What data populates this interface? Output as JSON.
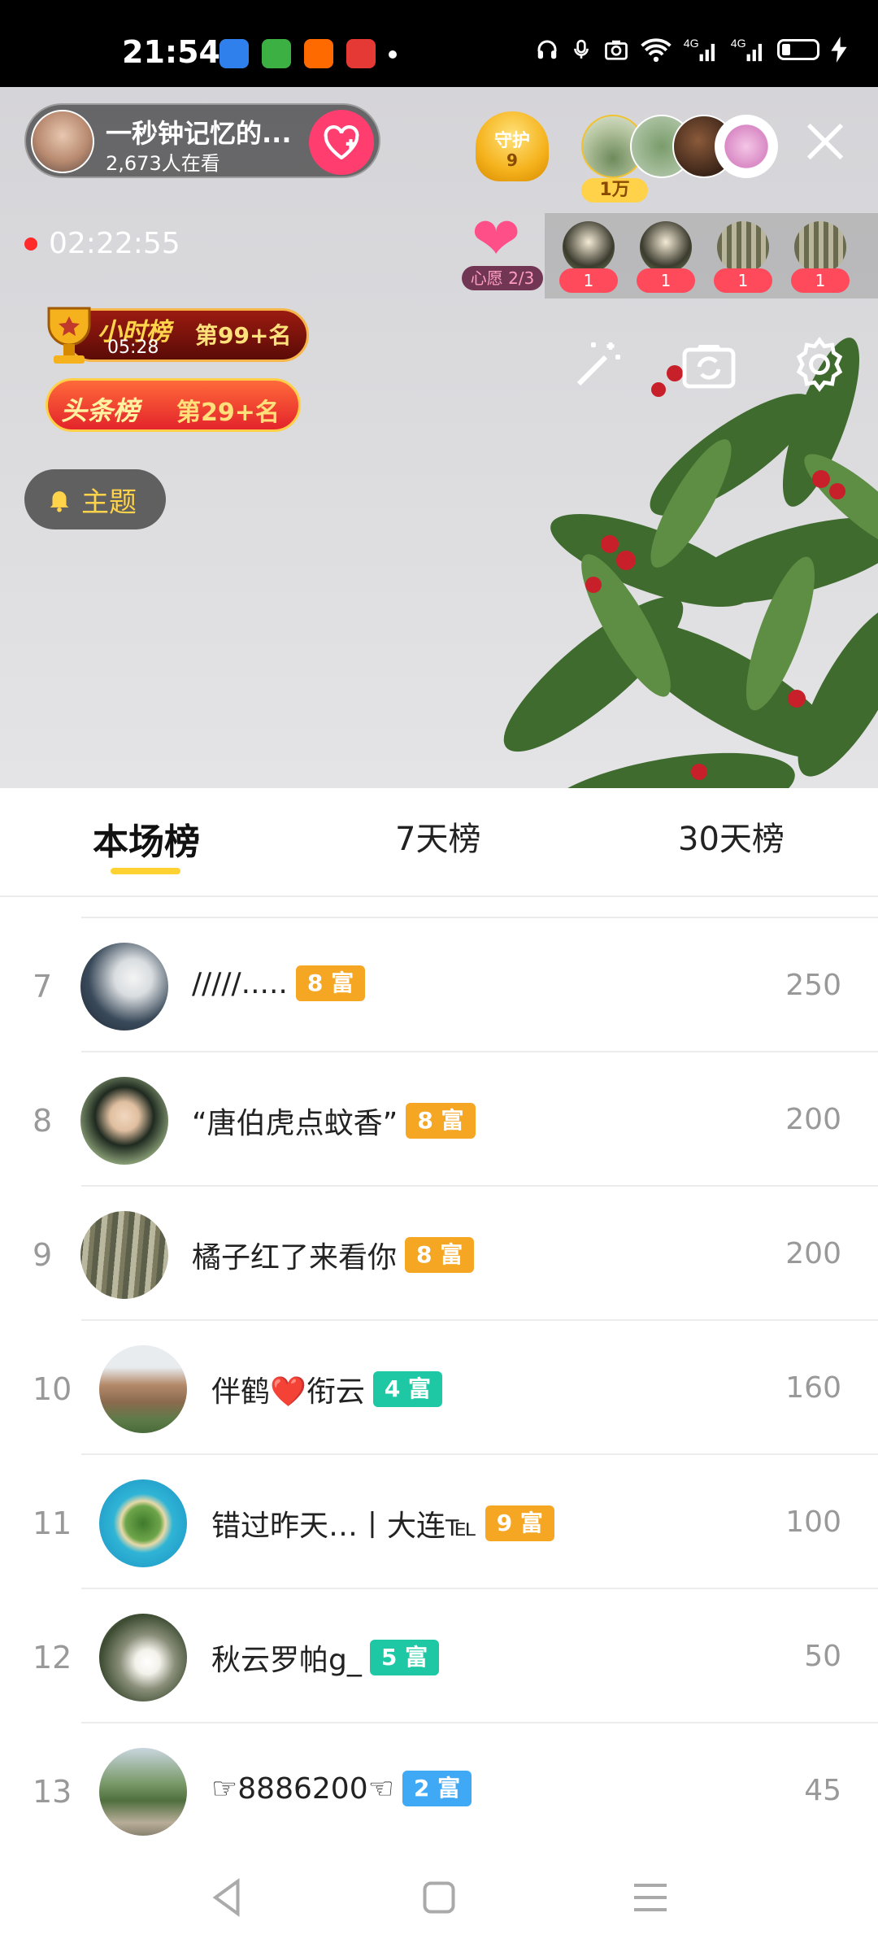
{
  "status_bar": {
    "time": "21:54",
    "icons": [
      "headphone-icon",
      "mic-icon",
      "camera-icon",
      "wifi-icon",
      "4g-signal-icon",
      "4g-signal-icon",
      "battery-icon",
      "charging-icon"
    ]
  },
  "live": {
    "host_name": "一秒钟记忆的...",
    "viewers": "2,673人在看",
    "guard_label": "守护",
    "guard_count": "9",
    "viewer_badge": "1万",
    "timer": "02:22:55",
    "wish_label": "心愿 2/3",
    "gift_counts": [
      "1",
      "1",
      "1",
      "1"
    ],
    "hour_rank_title": "小时榜",
    "hour_rank_countdown": "05:28",
    "hour_rank_position": "第99+名",
    "top_rank_title": "头条榜",
    "top_rank_position": "第29+名",
    "topic_label": "主题"
  },
  "tabs": [
    {
      "label": "本场榜",
      "active": true
    },
    {
      "label": "7天榜",
      "active": false
    },
    {
      "label": "30天榜",
      "active": false
    }
  ],
  "leaderboard": [
    {
      "rank": "7",
      "name": "/////.....",
      "level": "8 富",
      "score": "250",
      "badge_color": "#f5a623"
    },
    {
      "rank": "8",
      "name": "“唐伯虎点蚊香”",
      "level": "8 富",
      "score": "200",
      "badge_color": "#f5a623"
    },
    {
      "rank": "9",
      "name": "橘子红了来看你",
      "level": "8 富",
      "score": "200",
      "badge_color": "#f5a623"
    },
    {
      "rank": "10",
      "name": "伴鹤❤️衔云",
      "level": "4 富",
      "score": "160",
      "badge_color": "#1ec8a5"
    },
    {
      "rank": "11",
      "name": "错过昨天…丨大连℡",
      "level": "9 富",
      "score": "100",
      "badge_color": "#f5a623"
    },
    {
      "rank": "12",
      "name": "秋云罗帕g_",
      "level": "5 富",
      "score": "50",
      "badge_color": "#1ec8a5"
    },
    {
      "rank": "13",
      "name": "☞8886200☜",
      "level": "2 富",
      "score": "45",
      "badge_color": "#3fa9f5"
    }
  ]
}
